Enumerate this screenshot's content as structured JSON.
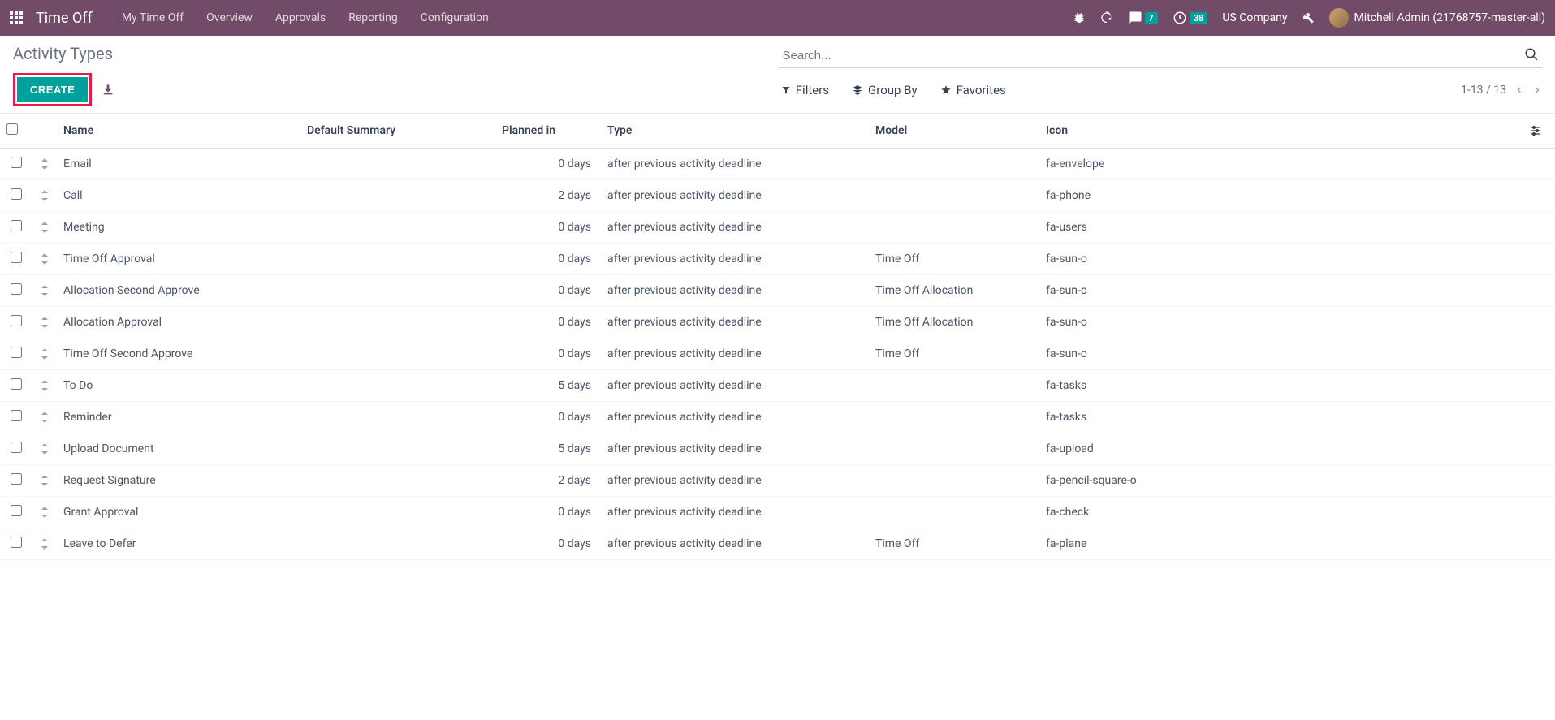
{
  "navbar": {
    "app_title": "Time Off",
    "menu": [
      "My Time Off",
      "Overview",
      "Approvals",
      "Reporting",
      "Configuration"
    ],
    "chat_badge": "7",
    "clock_badge": "38",
    "company": "US Company",
    "user": "Mitchell Admin (21768757-master-all)"
  },
  "page": {
    "title": "Activity Types",
    "search_placeholder": "Search...",
    "create_label": "CREATE",
    "filters_label": "Filters",
    "groupby_label": "Group By",
    "favorites_label": "Favorites",
    "pager": "1-13 / 13"
  },
  "table": {
    "headers": {
      "name": "Name",
      "summary": "Default Summary",
      "planned": "Planned in",
      "type": "Type",
      "model": "Model",
      "icon": "Icon"
    },
    "rows": [
      {
        "name": "Email",
        "summary": "",
        "planned": "0 days",
        "type": "after previous activity deadline",
        "model": "",
        "icon": "fa-envelope"
      },
      {
        "name": "Call",
        "summary": "",
        "planned": "2 days",
        "type": "after previous activity deadline",
        "model": "",
        "icon": "fa-phone"
      },
      {
        "name": "Meeting",
        "summary": "",
        "planned": "0 days",
        "type": "after previous activity deadline",
        "model": "",
        "icon": "fa-users"
      },
      {
        "name": "Time Off Approval",
        "summary": "",
        "planned": "0 days",
        "type": "after previous activity deadline",
        "model": "Time Off",
        "icon": "fa-sun-o"
      },
      {
        "name": "Allocation Second Approve",
        "summary": "",
        "planned": "0 days",
        "type": "after previous activity deadline",
        "model": "Time Off Allocation",
        "icon": "fa-sun-o"
      },
      {
        "name": "Allocation Approval",
        "summary": "",
        "planned": "0 days",
        "type": "after previous activity deadline",
        "model": "Time Off Allocation",
        "icon": "fa-sun-o"
      },
      {
        "name": "Time Off Second Approve",
        "summary": "",
        "planned": "0 days",
        "type": "after previous activity deadline",
        "model": "Time Off",
        "icon": "fa-sun-o"
      },
      {
        "name": "To Do",
        "summary": "",
        "planned": "5 days",
        "type": "after previous activity deadline",
        "model": "",
        "icon": "fa-tasks"
      },
      {
        "name": "Reminder",
        "summary": "",
        "planned": "0 days",
        "type": "after previous activity deadline",
        "model": "",
        "icon": "fa-tasks"
      },
      {
        "name": "Upload Document",
        "summary": "",
        "planned": "5 days",
        "type": "after previous activity deadline",
        "model": "",
        "icon": "fa-upload"
      },
      {
        "name": "Request Signature",
        "summary": "",
        "planned": "2 days",
        "type": "after previous activity deadline",
        "model": "",
        "icon": "fa-pencil-square-o"
      },
      {
        "name": "Grant Approval",
        "summary": "",
        "planned": "0 days",
        "type": "after previous activity deadline",
        "model": "",
        "icon": "fa-check"
      },
      {
        "name": "Leave to Defer",
        "summary": "",
        "planned": "0 days",
        "type": "after previous activity deadline",
        "model": "Time Off",
        "icon": "fa-plane"
      }
    ]
  }
}
